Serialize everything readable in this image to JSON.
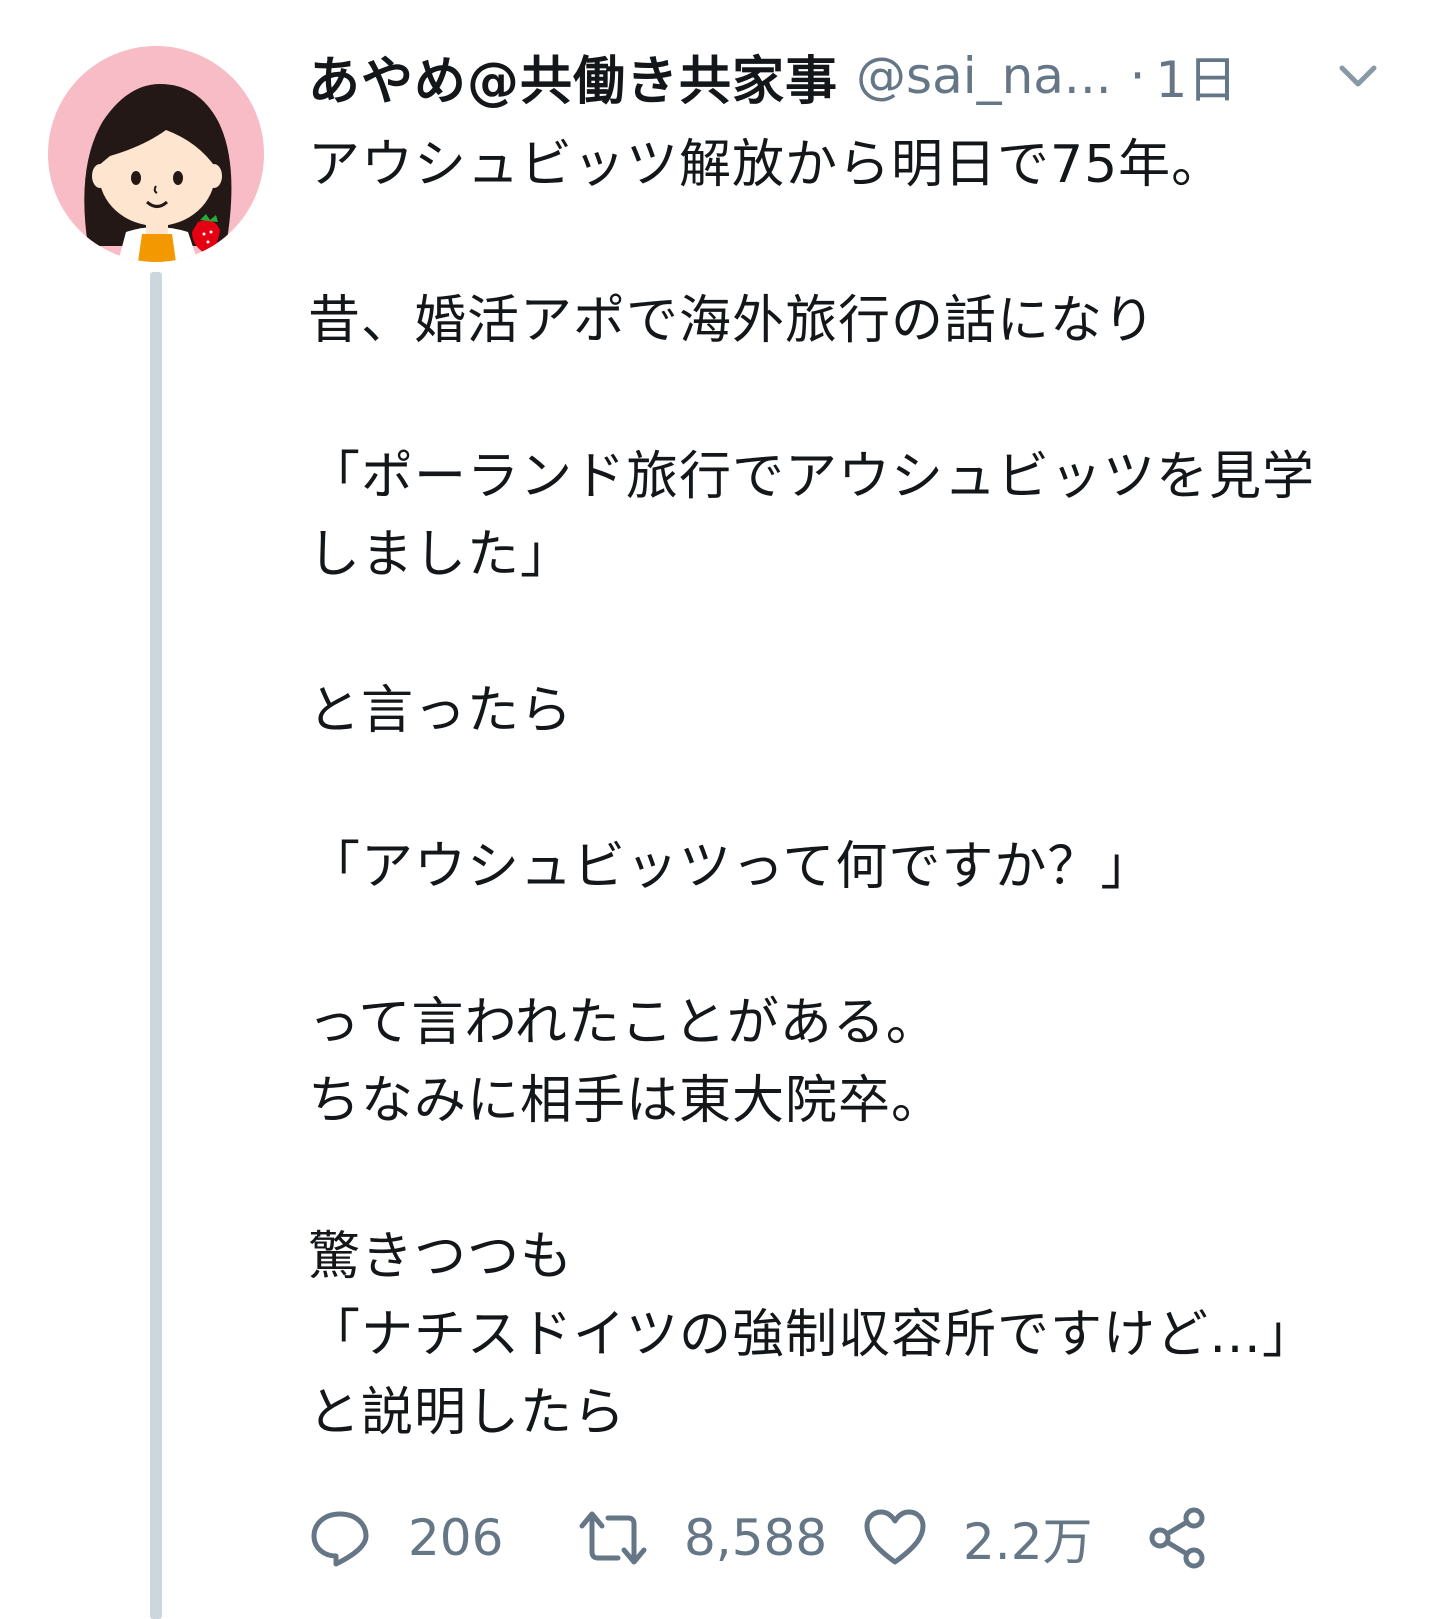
{
  "tweet": {
    "display_name": "あやめ@共働き共家事",
    "handle": "@sai_na...",
    "separator": "·",
    "time": "1日",
    "lines": [
      "アウシュビッツ解放から明日で75年。",
      "",
      "昔、婚活アポで海外旅行の話になり",
      "",
      "「ポーランド旅行でアウシュビッツを見学",
      "しました」",
      "",
      "と言ったら",
      "",
      "「アウシュビッツって何ですか？」",
      "",
      "って言われたことがある。",
      "ちなみに相手は東大院卒。",
      "",
      "驚きつつも",
      "「ナチスドイツの強制収容所ですけど…」",
      "と説明したら"
    ],
    "body": "アウシュビッツ解放から明日で75年。\n\n昔、婚活アポで海外旅行の話になり\n\n「ポーランド旅行でアウシュビッツを見学\nしました」\n\nと言ったら\n\n「アウシュビッツって何ですか？」\n\nって言われたことがある。\nちなみに相手は東大院卒。\n\n驚きつつも\n「ナチスドイツの強制収容所ですけど…」\nと説明したら"
  },
  "actions": {
    "reply_count": "206",
    "retweet_count": "8,588",
    "like_count": "2.2万"
  },
  "icons": {
    "reply": "reply-icon",
    "retweet": "retweet-icon",
    "like": "heart-icon",
    "share": "share-icon",
    "menu": "chevron-down-icon"
  },
  "colors": {
    "text": "#14171a",
    "secondary": "#657786",
    "thread_line": "#ccd6dd",
    "avatar_bg": "#f7bcc5"
  }
}
